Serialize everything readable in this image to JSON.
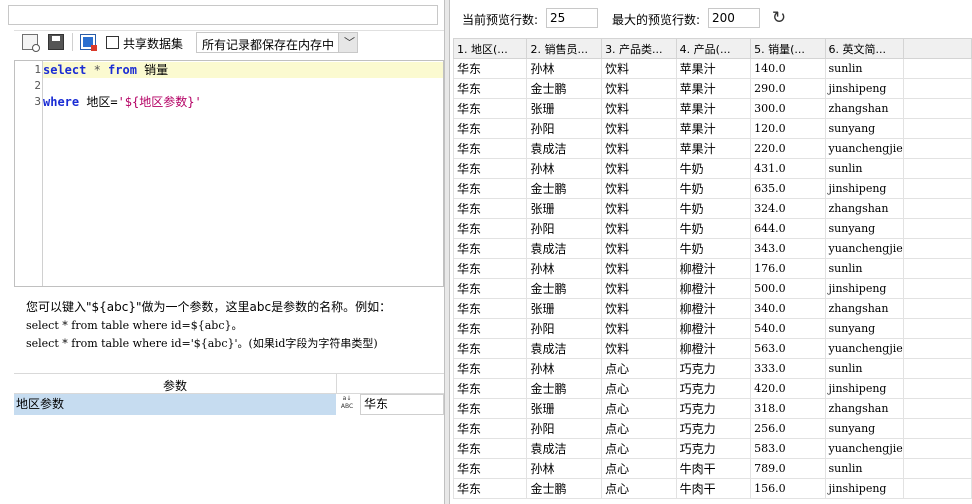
{
  "toolbar": {
    "share_label": "共享数据集",
    "mode_select_value": "所有记录都保存在内存中"
  },
  "editor": {
    "line_numbers": [
      "1",
      "2",
      "3"
    ],
    "line1": {
      "kw1": "select",
      "op": " * ",
      "kw2": "from",
      "table": " 销量"
    },
    "line3": {
      "kw": "where",
      "cond": " 地区=",
      "str": "'${地区参数}'"
    }
  },
  "hint": {
    "line1": "您可以键入\"${abc}\"做为一个参数，这里abc是参数的名称。例如：",
    "line2": "select * from table where id=${abc}。",
    "line3": "select * from table where id='${abc}'。(如果id字段为字符串类型)"
  },
  "params": {
    "header": "参数",
    "rows": [
      {
        "name": "地区参数",
        "type_icon": "abc-type-icon",
        "value": "华东"
      }
    ]
  },
  "preview": {
    "current_label": "当前预览行数:",
    "current_value": "25",
    "max_label": "最大的预览行数:",
    "max_value": "200"
  },
  "grid": {
    "columns": [
      "1. 地区(...",
      "2. 销售员...",
      "3. 产品类...",
      "4. 产品(...",
      "5. 销量(...",
      "6. 英文简..."
    ],
    "rows": [
      [
        "华东",
        "孙林",
        "饮料",
        "苹果汁",
        "140.0",
        "sunlin"
      ],
      [
        "华东",
        "金士鹏",
        "饮料",
        "苹果汁",
        "290.0",
        "jinshipeng"
      ],
      [
        "华东",
        "张珊",
        "饮料",
        "苹果汁",
        "300.0",
        "zhangshan"
      ],
      [
        "华东",
        "孙阳",
        "饮料",
        "苹果汁",
        "120.0",
        "sunyang"
      ],
      [
        "华东",
        "袁成洁",
        "饮料",
        "苹果汁",
        "220.0",
        "yuanchengjie"
      ],
      [
        "华东",
        "孙林",
        "饮料",
        "牛奶",
        "431.0",
        "sunlin"
      ],
      [
        "华东",
        "金士鹏",
        "饮料",
        "牛奶",
        "635.0",
        "jinshipeng"
      ],
      [
        "华东",
        "张珊",
        "饮料",
        "牛奶",
        "324.0",
        "zhangshan"
      ],
      [
        "华东",
        "孙阳",
        "饮料",
        "牛奶",
        "644.0",
        "sunyang"
      ],
      [
        "华东",
        "袁成洁",
        "饮料",
        "牛奶",
        "343.0",
        "yuanchengjie"
      ],
      [
        "华东",
        "孙林",
        "饮料",
        "柳橙汁",
        "176.0",
        "sunlin"
      ],
      [
        "华东",
        "金士鹏",
        "饮料",
        "柳橙汁",
        "500.0",
        "jinshipeng"
      ],
      [
        "华东",
        "张珊",
        "饮料",
        "柳橙汁",
        "340.0",
        "zhangshan"
      ],
      [
        "华东",
        "孙阳",
        "饮料",
        "柳橙汁",
        "540.0",
        "sunyang"
      ],
      [
        "华东",
        "袁成洁",
        "饮料",
        "柳橙汁",
        "563.0",
        "yuanchengjie"
      ],
      [
        "华东",
        "孙林",
        "点心",
        "巧克力",
        "333.0",
        "sunlin"
      ],
      [
        "华东",
        "金士鹏",
        "点心",
        "巧克力",
        "420.0",
        "jinshipeng"
      ],
      [
        "华东",
        "张珊",
        "点心",
        "巧克力",
        "318.0",
        "zhangshan"
      ],
      [
        "华东",
        "孙阳",
        "点心",
        "巧克力",
        "256.0",
        "sunyang"
      ],
      [
        "华东",
        "袁成洁",
        "点心",
        "巧克力",
        "583.0",
        "yuanchengjie"
      ],
      [
        "华东",
        "孙林",
        "点心",
        "牛肉干",
        "789.0",
        "sunlin"
      ],
      [
        "华东",
        "金士鹏",
        "点心",
        "牛肉干",
        "156.0",
        "jinshipeng"
      ]
    ]
  },
  "icons": {
    "preview": "preview-icon",
    "save": "save-icon",
    "datasource": "datasource-icon",
    "dropdown": "chevron-down-icon",
    "refresh": "refresh-icon"
  },
  "colors": {
    "keyword": "#1a2cd4",
    "string": "#b40064",
    "line_highlight": "#fbfad0",
    "param_selected": "#c6dcf0"
  }
}
